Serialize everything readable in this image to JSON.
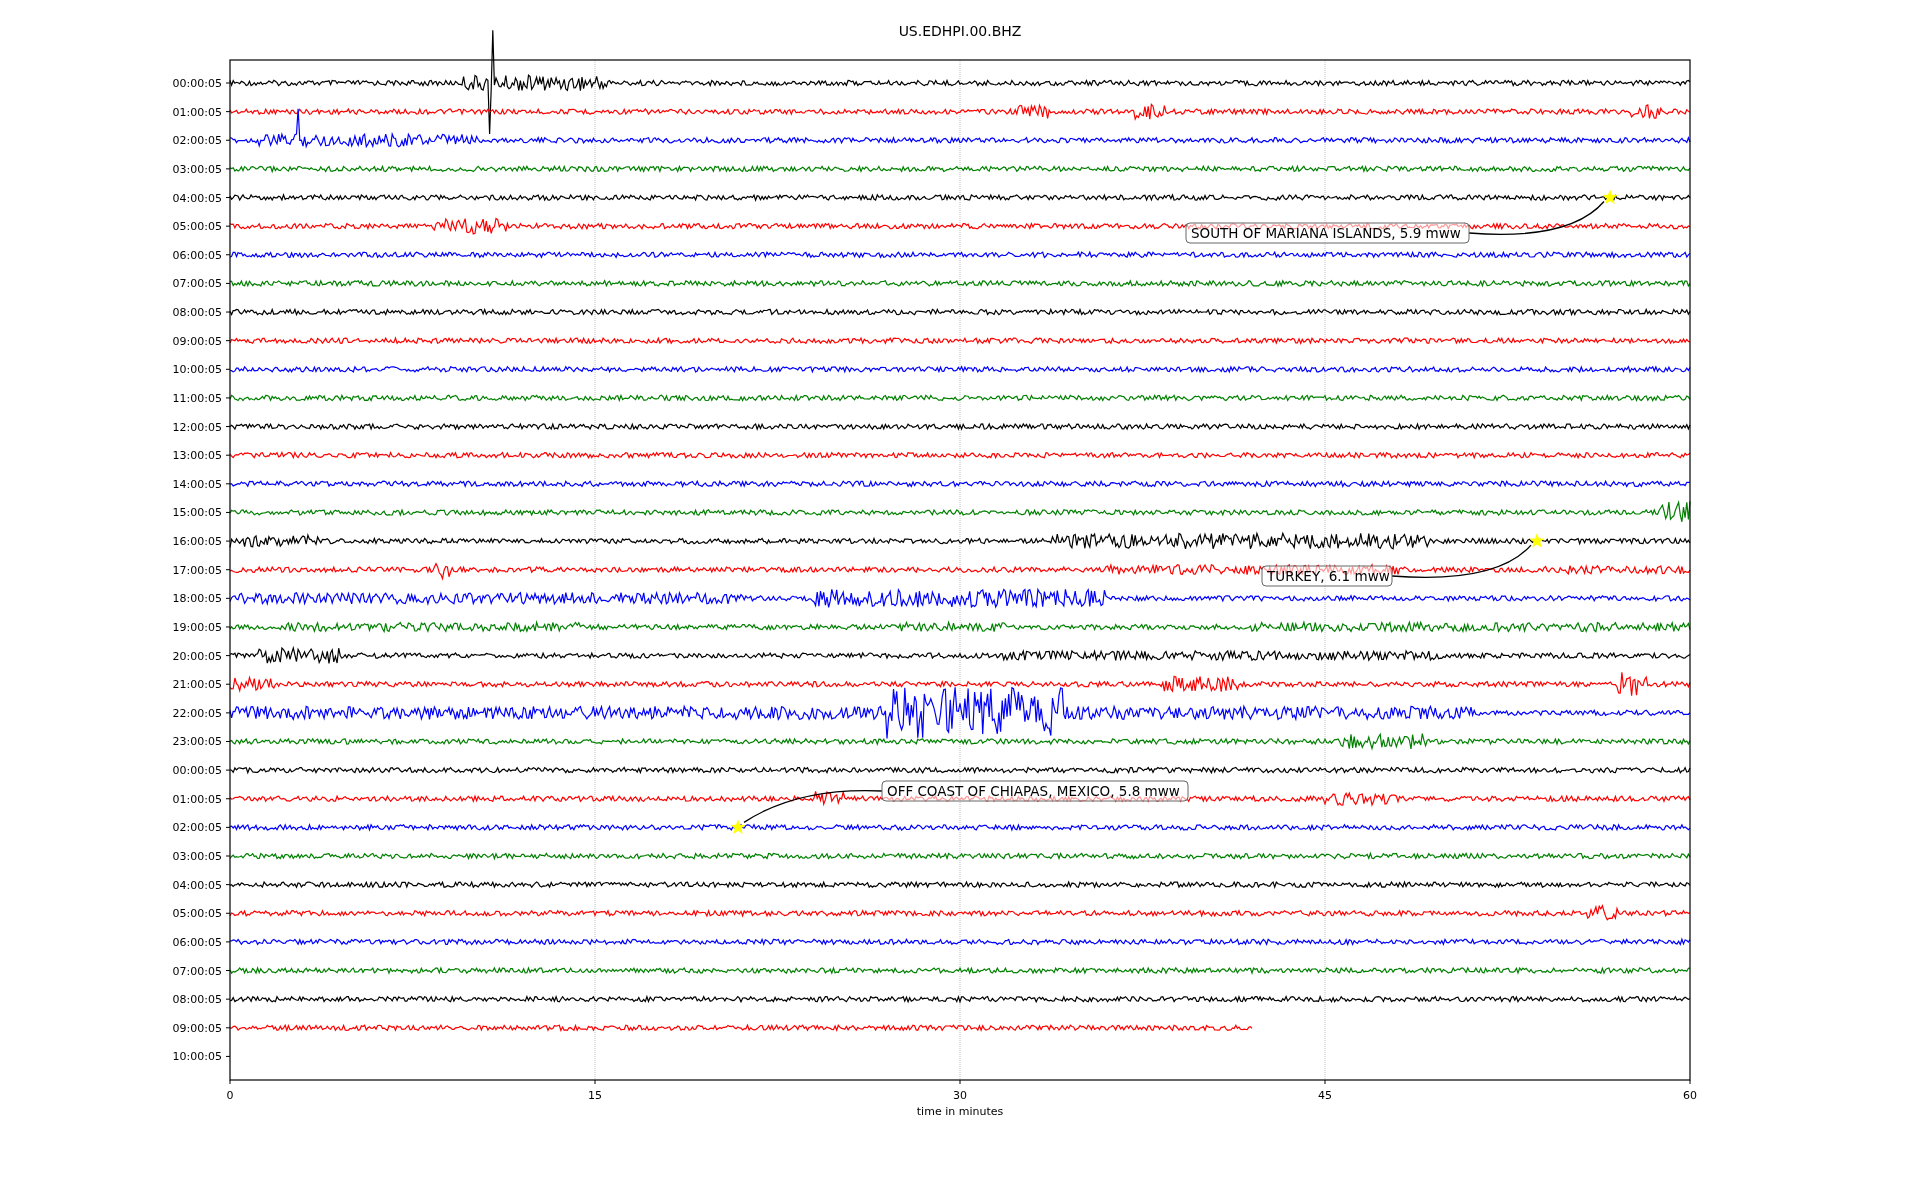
{
  "title": "US.EDHPI.00.BHZ",
  "rows": [
    {
      "label": "00:00:05",
      "color": "#000000"
    },
    {
      "label": "01:00:05",
      "color": "#ff0000"
    },
    {
      "label": "02:00:05",
      "color": "#0000ff"
    },
    {
      "label": "03:00:05",
      "color": "#008000"
    },
    {
      "label": "04:00:05",
      "color": "#000000"
    },
    {
      "label": "05:00:05",
      "color": "#ff0000"
    },
    {
      "label": "06:00:05",
      "color": "#0000ff"
    },
    {
      "label": "07:00:05",
      "color": "#008000"
    },
    {
      "label": "08:00:05",
      "color": "#000000"
    },
    {
      "label": "09:00:05",
      "color": "#ff0000"
    },
    {
      "label": "10:00:05",
      "color": "#0000ff"
    },
    {
      "label": "11:00:05",
      "color": "#008000"
    },
    {
      "label": "12:00:05",
      "color": "#000000"
    },
    {
      "label": "13:00:05",
      "color": "#ff0000"
    },
    {
      "label": "14:00:05",
      "color": "#0000ff"
    },
    {
      "label": "15:00:05",
      "color": "#008000"
    },
    {
      "label": "16:00:05",
      "color": "#000000"
    },
    {
      "label": "17:00:05",
      "color": "#ff0000"
    },
    {
      "label": "18:00:05",
      "color": "#0000ff"
    },
    {
      "label": "19:00:05",
      "color": "#008000"
    },
    {
      "label": "20:00:05",
      "color": "#000000"
    },
    {
      "label": "21:00:05",
      "color": "#ff0000"
    },
    {
      "label": "22:00:05",
      "color": "#0000ff"
    },
    {
      "label": "23:00:05",
      "color": "#008000"
    },
    {
      "label": "00:00:05",
      "color": "#000000"
    },
    {
      "label": "01:00:05",
      "color": "#ff0000"
    },
    {
      "label": "02:00:05",
      "color": "#0000ff"
    },
    {
      "label": "03:00:05",
      "color": "#008000"
    },
    {
      "label": "04:00:05",
      "color": "#000000"
    },
    {
      "label": "05:00:05",
      "color": "#ff0000"
    },
    {
      "label": "06:00:05",
      "color": "#0000ff"
    },
    {
      "label": "07:00:05",
      "color": "#008000"
    },
    {
      "label": "08:00:05",
      "color": "#000000"
    },
    {
      "label": "09:00:05",
      "color": "#ff0000",
      "level": 0.7
    },
    {
      "label": "10:00:05"
    }
  ],
  "xticks": [
    "0",
    "15",
    "30",
    "45",
    "60"
  ],
  "xlabel": "time in minutes",
  "events": [
    {
      "label": "SOUTH OF MARIANA ISLANDS, 5.9 mww"
    },
    {
      "label": "TURKEY, 6.1 mww"
    },
    {
      "label": "OFF COAST OF CHIAPAS, MEXICO, 5.8 mww"
    }
  ]
}
